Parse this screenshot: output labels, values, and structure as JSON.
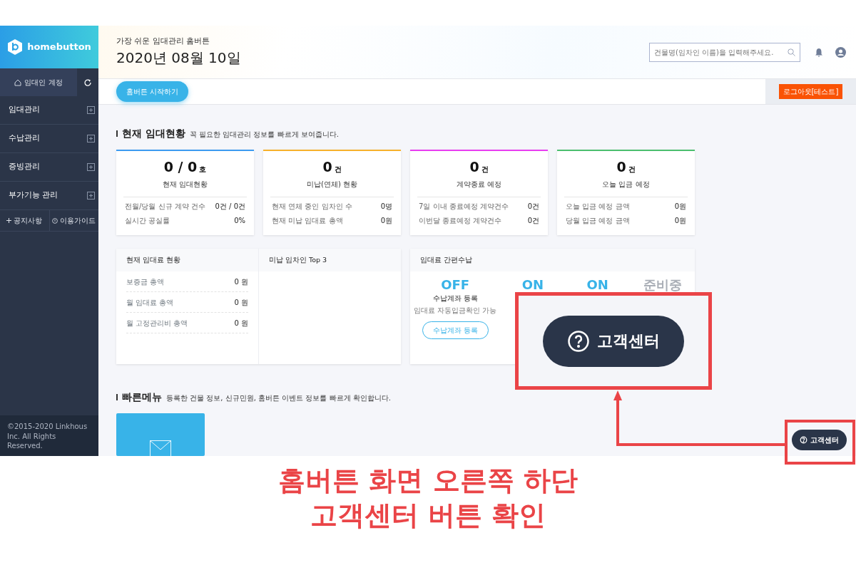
{
  "sidebar": {
    "logo": "homebutton",
    "account": "임대인 계정",
    "menu": [
      {
        "label": "임대관리",
        "expanded": false
      },
      {
        "label": "수납관리",
        "expanded": false
      },
      {
        "label": "증빙관리",
        "expanded": false
      },
      {
        "label": "부가기능 관리",
        "expanded": false
      }
    ],
    "links": [
      "공지사항",
      "이용가이드"
    ],
    "copyright": "©2015-2020 Linkhous Inc. All Rights Reserved."
  },
  "header": {
    "subtitle": "가장 쉬운 임대관리 홈버튼",
    "date": "2020년 08월 10일",
    "search": {
      "placeholder": "건물명(임차인 이름)을 입력해주세요."
    },
    "start_button": "홈버튼 시작하기",
    "logout_button": "로그아웃[테스트]"
  },
  "status_section": {
    "title": "현재 임대현황",
    "description": "꼭 필요한 임대관리 정보를 빠르게 보여줍니다.",
    "cards": [
      {
        "value": "0 / 0",
        "unit": "호",
        "label": "현재 임대현황",
        "color": "#3d9bf0",
        "rows": [
          {
            "label": "전월/당월 신규 계약 건수",
            "value": "0건 / 0건"
          },
          {
            "label": "실시간 공실률",
            "value": "0%"
          }
        ]
      },
      {
        "value": "0",
        "unit": "건",
        "label": "미납(연체) 현황",
        "color": "#f7b12c",
        "rows": [
          {
            "label": "현재 연체 중인 임차인 수",
            "value": "0명"
          },
          {
            "label": "현재 미납 임대료 총액",
            "value": "0원"
          }
        ]
      },
      {
        "value": "0",
        "unit": "건",
        "label": "계약종료 예정",
        "color": "#e83ef0",
        "rows": [
          {
            "label": "7일 이내 종료예정 계약건수",
            "value": "0건"
          },
          {
            "label": "이번달 종료예정 계약건수",
            "value": "0건"
          }
        ]
      },
      {
        "value": "0",
        "unit": "건",
        "label": "오늘 입금 예정",
        "color": "#4cbf6f",
        "rows": [
          {
            "label": "오늘 입금 예정 금액",
            "value": "0원"
          },
          {
            "label": "당월 입금 예정 금액",
            "value": "0원"
          }
        ]
      }
    ]
  },
  "rent_panel": {
    "title": "현재 임대료 현황",
    "rows": [
      {
        "label": "보증금 총액",
        "value": "0 원"
      },
      {
        "label": "월 임대료 총액",
        "value": "0 원"
      },
      {
        "label": "월 고정관리비 총액",
        "value": "0 원"
      }
    ]
  },
  "top3_panel": {
    "title": "미납 임차인 Top 3"
  },
  "collect_panel": {
    "title": "임대료 간편수납",
    "items": [
      {
        "status": "OFF",
        "disabled": false,
        "title": "수납계좌 등록",
        "note": "임대료 자동입금확인 가능",
        "button": "수납계좌 등록"
      },
      {
        "status": "ON",
        "disabled": false
      },
      {
        "status": "ON",
        "disabled": false
      },
      {
        "status": "준비중",
        "disabled": true
      }
    ]
  },
  "quick_menu": {
    "title": "빠른메뉴",
    "description": "등록한 건물 정보, 신규민원, 홈버튼 이벤트 정보를 빠르게 확인합니다."
  },
  "help_button": "고객센터",
  "callout": {
    "zoom_label": "고객센터",
    "caption": [
      "홈버튼 화면 오른쪽 하단",
      "고객센터 버튼 확인"
    ]
  }
}
